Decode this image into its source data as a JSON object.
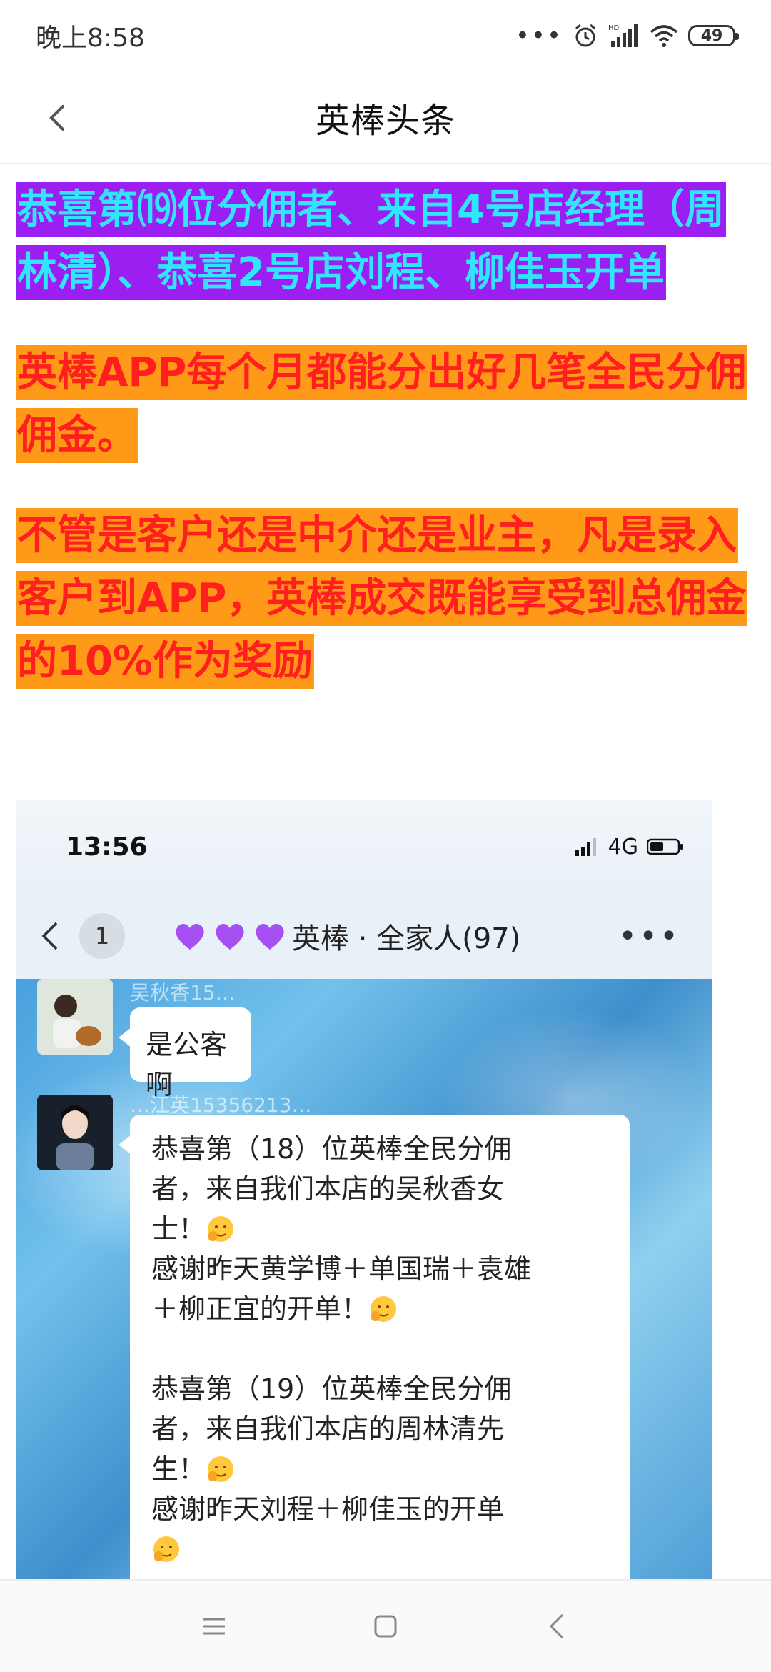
{
  "status_bar": {
    "time": "晚上8:58",
    "dots": "•••",
    "battery": "49",
    "network": "HD"
  },
  "nav": {
    "title": "英棒头条"
  },
  "article": {
    "paragraphs": [
      "恭喜第⒆位分佣者、来自4号店经理（周林清）、恭喜2号店刘程、柳佳玉开单",
      "英棒APP每个月都能分出好几笔全民分佣佣金。",
      "不管是客户还是中介还是业主，凡是录入客户到APP，英棒成交既能享受到总佣金的10%作为奖励"
    ],
    "colors": {
      "p1_bg": "#9b1ff0",
      "p1_text": "#31e5ff",
      "p2_bg": "#ff9a18",
      "p2_text": "#ff1f1f"
    }
  },
  "embedded_screenshot": {
    "status_time": "13:56",
    "network": "4G",
    "back_badge": "1",
    "group_name": "英棒 · 全家人(97)",
    "more": "•••",
    "messages": [
      {
        "sender": "吴秋香15…",
        "text": "是公客啊"
      },
      {
        "sender": "…江英15356213…",
        "lines": [
          "恭喜第（18）位英棒全民分佣",
          "者，来自我们本店的吴秋香女",
          "士！",
          "感谢昨天黄学博＋单国瑞＋袁雄",
          "＋柳正宜的开单！",
          "",
          "恭喜第（19）位英棒全民分佣",
          "者，来自我们本店的周林清先",
          "生！",
          "感谢昨天刘程＋柳佳玉的开单",
          ""
        ]
      }
    ]
  },
  "bottom_nav": {
    "menu_icon": "menu-icon",
    "home_icon": "home-icon",
    "back_icon": "back-icon"
  }
}
